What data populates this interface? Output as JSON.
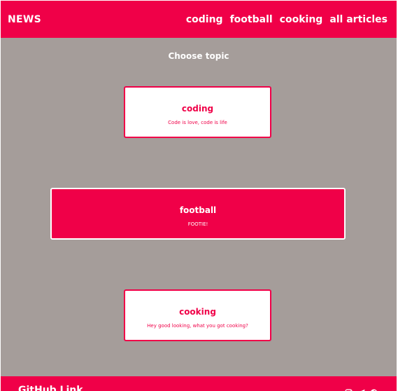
{
  "navbar": {
    "brand": "NEWS",
    "links": [
      "coding",
      "football",
      "cooking",
      "all articles"
    ]
  },
  "main": {
    "heading": "Choose topic",
    "topics": [
      {
        "title": "coding",
        "description": "Code is love, code is life",
        "active": false
      },
      {
        "title": "football",
        "description": "FOOTIE!",
        "active": true
      },
      {
        "title": "cooking",
        "description": "Hey good looking, what you got cooking?",
        "active": false
      }
    ]
  },
  "footer": {
    "github_label": "GitHub Link",
    "social_icons": [
      "instagram-icon",
      "telegram-icon",
      "facebook-icon"
    ]
  },
  "colors": {
    "accent": "#f00048",
    "background": "#a59d9a",
    "card_background": "#ffffff"
  }
}
